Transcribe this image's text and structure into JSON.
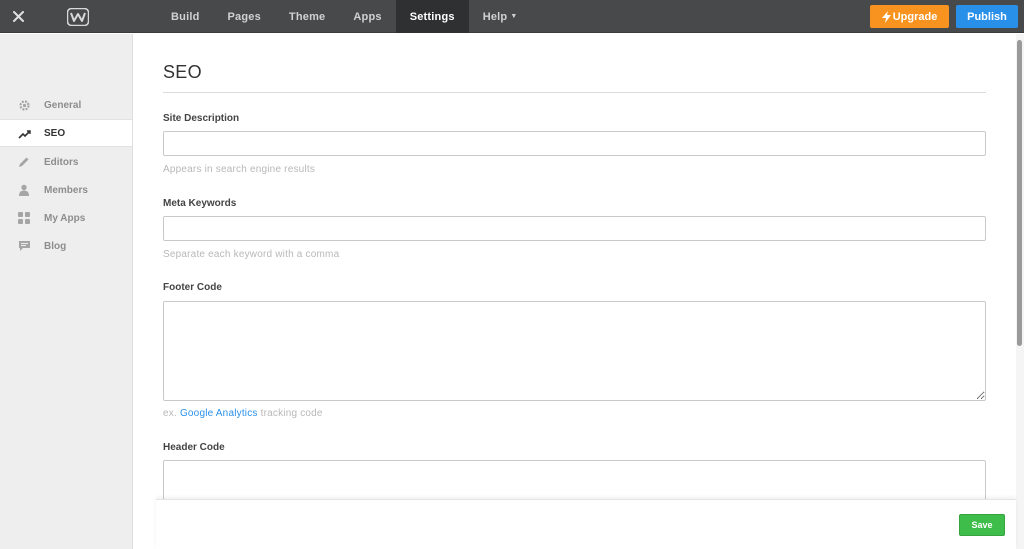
{
  "topbar": {
    "nav": [
      {
        "label": "Build"
      },
      {
        "label": "Pages"
      },
      {
        "label": "Theme"
      },
      {
        "label": "Apps"
      },
      {
        "label": "Settings"
      },
      {
        "label": "Help"
      }
    ],
    "upgrade_label": "Upgrade",
    "publish_label": "Publish",
    "colors": {
      "bar": "#48494b",
      "active": "#2f3032",
      "upgrade": "#f7931e",
      "publish": "#2990ea"
    }
  },
  "sidebar": {
    "items": [
      {
        "label": "General",
        "icon": "gear-icon"
      },
      {
        "label": "SEO",
        "icon": "trend-icon"
      },
      {
        "label": "Editors",
        "icon": "pencil-icon"
      },
      {
        "label": "Members",
        "icon": "person-icon"
      },
      {
        "label": "My Apps",
        "icon": "grid-icon"
      },
      {
        "label": "Blog",
        "icon": "comment-icon"
      }
    ]
  },
  "main": {
    "title": "SEO",
    "site_description": {
      "label": "Site Description",
      "value": "",
      "hint": "Appears in search engine results"
    },
    "meta_keywords": {
      "label": "Meta Keywords",
      "value": "",
      "hint": "Separate each keyword with a comma"
    },
    "footer_code": {
      "label": "Footer Code",
      "value": "",
      "hint_prefix": "ex.",
      "hint_link": "Google Analytics",
      "hint_suffix": "tracking code"
    },
    "header_code": {
      "label": "Header Code",
      "value": ""
    }
  },
  "footer": {
    "save_label": "Save",
    "save_color": "#3ebd4a"
  }
}
